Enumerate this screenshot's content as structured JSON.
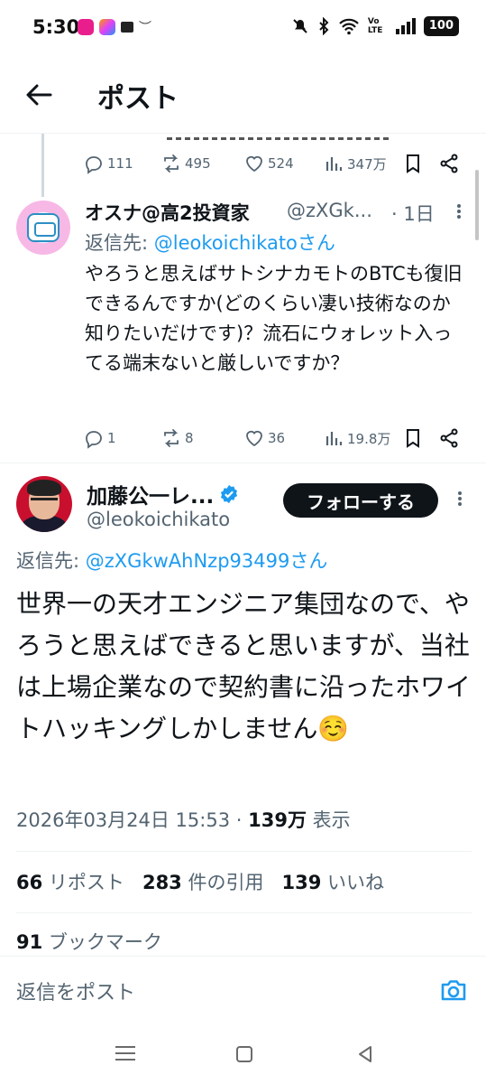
{
  "status_bar": {
    "time": "5:30",
    "volte": "Vo LTE",
    "battery": "100"
  },
  "header": {
    "title": "ポスト"
  },
  "previous_post_actions": {
    "replies": "111",
    "reposts": "495",
    "likes": "524",
    "views": "347万"
  },
  "reply_post": {
    "author_name": "オスナ@高2投資家",
    "handle": "@zXGk...",
    "time": "· 1日",
    "reply_to_prefix": "返信先: ",
    "reply_to_mention": "@leokoichikatoさん",
    "body": "やろうと思えばサトシナカモトのBTCも復旧できるんですか(どのくらい凄い技術なのか知りたいだけです)？流石にウォレット入ってる端末ないと厳しいですか？",
    "replies": "1",
    "reposts": "8",
    "likes": "36",
    "views": "19.8万"
  },
  "main_post": {
    "author_name": "加藤公一レ...",
    "handle": "@leokoichikato",
    "follow_label": "フォローする",
    "reply_to_prefix": "返信先: ",
    "reply_to_mention": "@zXGkwAhNzp93499さん",
    "body": "世界一の天才エンジニア集団なので、やろうと思えばできると思いますが、当社は上場企業なので契約書に沿ったホワイトハッキングしかしません☺️",
    "timestamp": "2026年03月24日 15:53 · ",
    "views_count": "139万",
    "views_label": " 表示",
    "reposts_count": "66",
    "reposts_label": " リポスト",
    "quotes_count": "283",
    "quotes_label": " 件の引用",
    "likes_count": "139",
    "likes_label": " いいね",
    "bookmarks_count": "91",
    "bookmarks_label": " ブックマーク"
  },
  "composer": {
    "placeholder": "返信をポスト"
  },
  "colors": {
    "accent": "#1d9bf0",
    "text": "#0f1419",
    "secondary": "#536471"
  }
}
